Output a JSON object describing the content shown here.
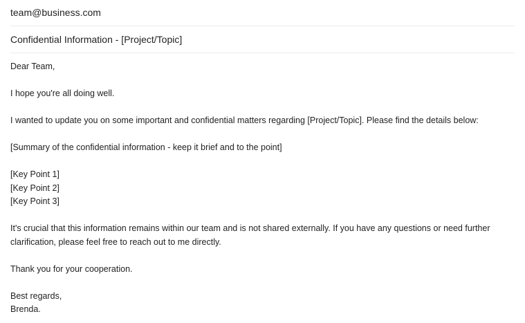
{
  "email": {
    "to": "team@business.com",
    "subject": "Confidential Information - [Project/Topic]",
    "body": {
      "greeting": "Dear Team,",
      "intro": "I hope you're all doing well.",
      "update": "I wanted to update you on some important and confidential matters regarding [Project/Topic]. Please find the details below:",
      "summary": "[Summary of the confidential information - keep it brief and to the point]",
      "key_points": [
        "[Key Point 1]",
        "[Key Point 2]",
        "[Key Point 3]"
      ],
      "crucial_line1": "It's crucial that this information remains within our team and is not shared externally. If you have any questions or need further",
      "crucial_line2": "clarification, please feel free to reach out to me directly.",
      "thanks": "Thank you for your cooperation.",
      "closing": "Best regards,",
      "signature": "Brenda."
    }
  }
}
